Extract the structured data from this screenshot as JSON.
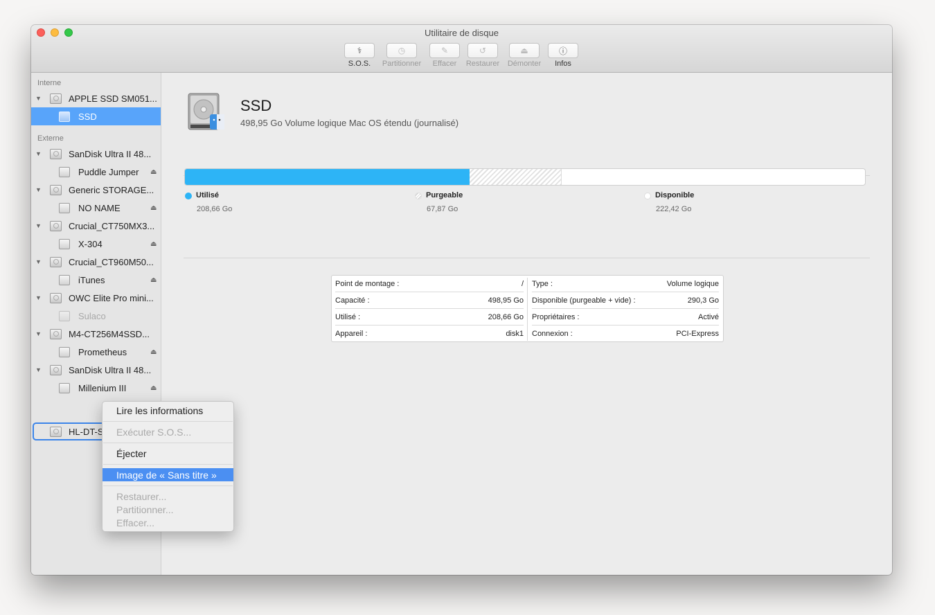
{
  "window": {
    "title": "Utilitaire de disque"
  },
  "toolbar": [
    {
      "label": "S.O.S.",
      "icon": "stethoscope-icon",
      "glyph": "⚕",
      "enabled": true
    },
    {
      "label": "Partitionner",
      "icon": "partition-icon",
      "glyph": "◷",
      "enabled": false
    },
    {
      "label": "Effacer",
      "icon": "erase-icon",
      "glyph": "✎",
      "enabled": false
    },
    {
      "label": "Restaurer",
      "icon": "restore-icon",
      "glyph": "↺",
      "enabled": false
    },
    {
      "label": "Démonter",
      "icon": "unmount-icon",
      "glyph": "⏏",
      "enabled": false
    },
    {
      "label": "Infos",
      "icon": "info-icon",
      "glyph": "ⓘ",
      "enabled": true
    }
  ],
  "sidebar": {
    "sections": [
      {
        "label": "Interne"
      },
      {
        "label": "Externe"
      }
    ],
    "internal_items": [
      {
        "label": "APPLE SSD SM051...",
        "type": "drive"
      },
      {
        "label": "SSD",
        "type": "volume",
        "selected": true
      }
    ],
    "external_items": [
      {
        "label": "SanDisk Ultra II 48...",
        "type": "drive"
      },
      {
        "label": "Puddle Jumper",
        "type": "volume",
        "eject": true
      },
      {
        "label": "Generic STORAGE...",
        "type": "drive"
      },
      {
        "label": "NO NAME",
        "type": "volume",
        "eject": true
      },
      {
        "label": "Crucial_CT750MX3...",
        "type": "drive"
      },
      {
        "label": "X-304",
        "type": "volume",
        "eject": true
      },
      {
        "label": "Crucial_CT960M50...",
        "type": "drive"
      },
      {
        "label": "iTunes",
        "type": "volume",
        "eject": true
      },
      {
        "label": "OWC Elite Pro mini...",
        "type": "drive"
      },
      {
        "label": "Sulaco",
        "type": "volume",
        "dim": true
      },
      {
        "label": "M4-CT256M4SSD...",
        "type": "drive"
      },
      {
        "label": "Prometheus",
        "type": "volume",
        "eject": true
      },
      {
        "label": "SanDisk Ultra II 48...",
        "type": "drive"
      },
      {
        "label": "Millenium III",
        "type": "volume",
        "eject": true
      },
      {
        "label": "HL-DT-S",
        "type": "drive",
        "focused": true
      }
    ]
  },
  "volume": {
    "name": "SSD",
    "description": "498,95 Go Volume logique Mac OS étendu (journalisé)"
  },
  "usage": {
    "capacity_go": 498.95,
    "legend": [
      {
        "name": "Utilisé",
        "value": "208,66 Go",
        "color": "#2db4f6"
      },
      {
        "name": "Purgeable",
        "value": "67,87 Go",
        "color": "#e2e2e2"
      },
      {
        "name": "Disponible",
        "value": "222,42 Go",
        "color": "#ffffff"
      }
    ],
    "used_go": 208.66,
    "purgeable_go": 67.87,
    "available_go": 222.42
  },
  "info_table": {
    "left": [
      {
        "key": "Point de montage :",
        "value": "/"
      },
      {
        "key": "Capacité :",
        "value": "498,95 Go"
      },
      {
        "key": "Utilisé :",
        "value": "208,66 Go"
      },
      {
        "key": "Appareil :",
        "value": "disk1"
      }
    ],
    "right": [
      {
        "key": "Type :",
        "value": "Volume logique"
      },
      {
        "key": "Disponible (purgeable + vide) :",
        "value": "290,3 Go"
      },
      {
        "key": "Propriétaires :",
        "value": "Activé"
      },
      {
        "key": "Connexion :",
        "value": "PCI-Express"
      }
    ]
  },
  "context_menu": {
    "items": [
      {
        "label": "Lire les informations",
        "enabled": true
      },
      {
        "label": "Exécuter S.O.S...",
        "enabled": false
      },
      {
        "label": "Éjecter",
        "enabled": true
      },
      {
        "label": "Image de « Sans titre »",
        "enabled": true,
        "highlighted": true
      },
      {
        "label": "Restaurer...",
        "enabled": false
      },
      {
        "label": "Partitionner...",
        "enabled": false
      },
      {
        "label": "Effacer...",
        "enabled": false
      }
    ]
  }
}
